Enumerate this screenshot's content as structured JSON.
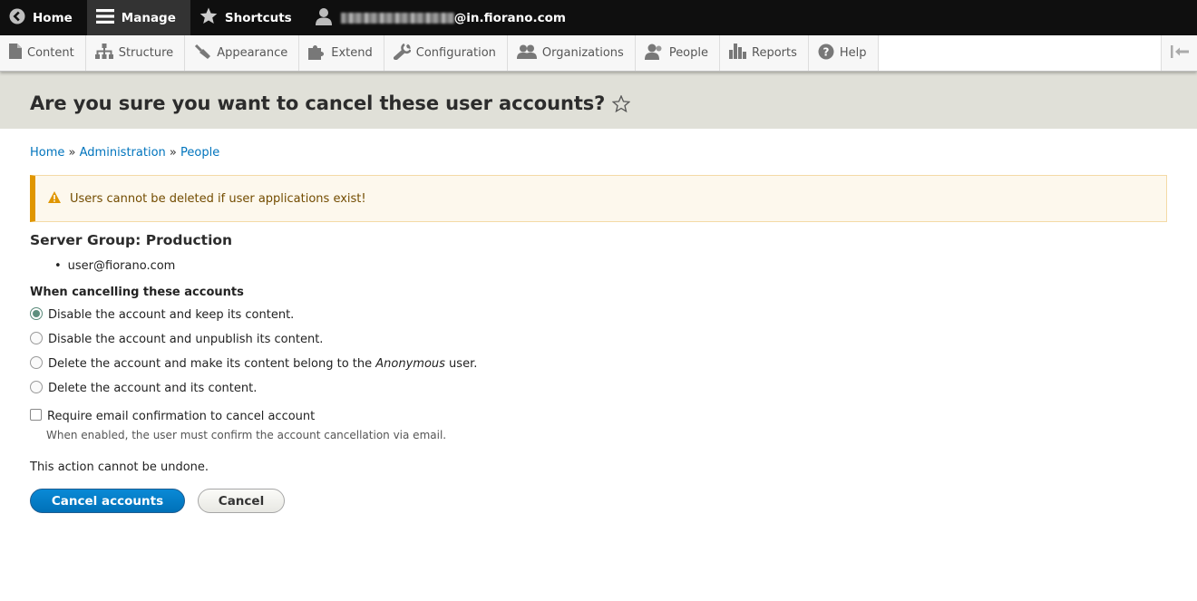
{
  "toolbar": {
    "home_label": "Home",
    "manage_label": "Manage",
    "shortcuts_label": "Shortcuts",
    "user_email_domain": "@in.fiorano.com"
  },
  "tray": {
    "items": [
      {
        "label": "Content",
        "icon": "file-icon"
      },
      {
        "label": "Structure",
        "icon": "structure-icon"
      },
      {
        "label": "Appearance",
        "icon": "brush-icon"
      },
      {
        "label": "Extend",
        "icon": "puzzle-icon"
      },
      {
        "label": "Configuration",
        "icon": "wrench-icon"
      },
      {
        "label": "Organizations",
        "icon": "group-icon"
      },
      {
        "label": "People",
        "icon": "people-icon"
      },
      {
        "label": "Reports",
        "icon": "bar-chart-icon"
      },
      {
        "label": "Help",
        "icon": "help-icon"
      }
    ]
  },
  "page": {
    "title": "Are you sure you want to cancel these user accounts?"
  },
  "breadcrumb": {
    "home": "Home",
    "administration": "Administration",
    "people": "People",
    "separator": "»"
  },
  "warning": {
    "message": "Users cannot be deleted if user applications exist!"
  },
  "group": {
    "heading": "Server Group: Production",
    "users": [
      "user@fiorano.com"
    ]
  },
  "cancel_method": {
    "label": "When cancelling these accounts",
    "options": [
      {
        "text": "Disable the account and keep its content.",
        "checked": true
      },
      {
        "text": "Disable the account and unpublish its content.",
        "checked": false
      },
      {
        "text_before": "Delete the account and make its content belong to the ",
        "emphasis": "Anonymous",
        "text_after": " user.",
        "checked": false
      },
      {
        "text": "Delete the account and its content.",
        "checked": false
      }
    ]
  },
  "email_confirm": {
    "label": "Require email confirmation to cancel account",
    "description": "When enabled, the user must confirm the account cancellation via email.",
    "checked": false
  },
  "notice": "This action cannot be undone.",
  "actions": {
    "primary_label": "Cancel accounts",
    "secondary_label": "Cancel"
  }
}
